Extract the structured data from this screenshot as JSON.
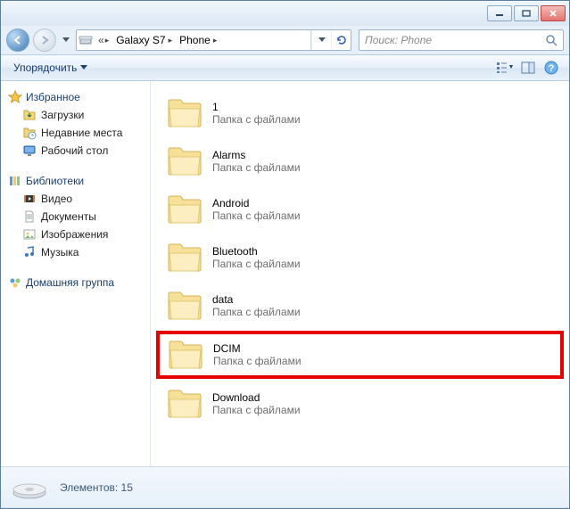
{
  "breadcrumbs": [
    {
      "label": "Galaxy S7"
    },
    {
      "label": "Phone"
    }
  ],
  "search": {
    "placeholder": "Поиск: Phone"
  },
  "toolbar": {
    "organize": "Упорядочить"
  },
  "sidebar": {
    "favorites": {
      "label": "Избранное",
      "items": [
        {
          "label": "Загрузки",
          "icon": "download-icon"
        },
        {
          "label": "Недавние места",
          "icon": "recent-icon"
        },
        {
          "label": "Рабочий стол",
          "icon": "desktop-icon"
        }
      ]
    },
    "libraries": {
      "label": "Библиотеки",
      "items": [
        {
          "label": "Видео",
          "icon": "video-icon"
        },
        {
          "label": "Документы",
          "icon": "documents-icon"
        },
        {
          "label": "Изображения",
          "icon": "pictures-icon"
        },
        {
          "label": "Музыка",
          "icon": "music-icon"
        }
      ]
    },
    "homegroup": {
      "label": "Домашняя группа"
    }
  },
  "folders": [
    {
      "name": "1",
      "type": "Папка с файлами",
      "highlight": false
    },
    {
      "name": "Alarms",
      "type": "Папка с файлами",
      "highlight": false
    },
    {
      "name": "Android",
      "type": "Папка с файлами",
      "highlight": false
    },
    {
      "name": "Bluetooth",
      "type": "Папка с файлами",
      "highlight": false
    },
    {
      "name": "data",
      "type": "Папка с файлами",
      "highlight": false
    },
    {
      "name": "DCIM",
      "type": "Папка с файлами",
      "highlight": true
    },
    {
      "name": "Download",
      "type": "Папка с файлами",
      "highlight": false
    }
  ],
  "status": {
    "text": "Элементов: 15"
  }
}
